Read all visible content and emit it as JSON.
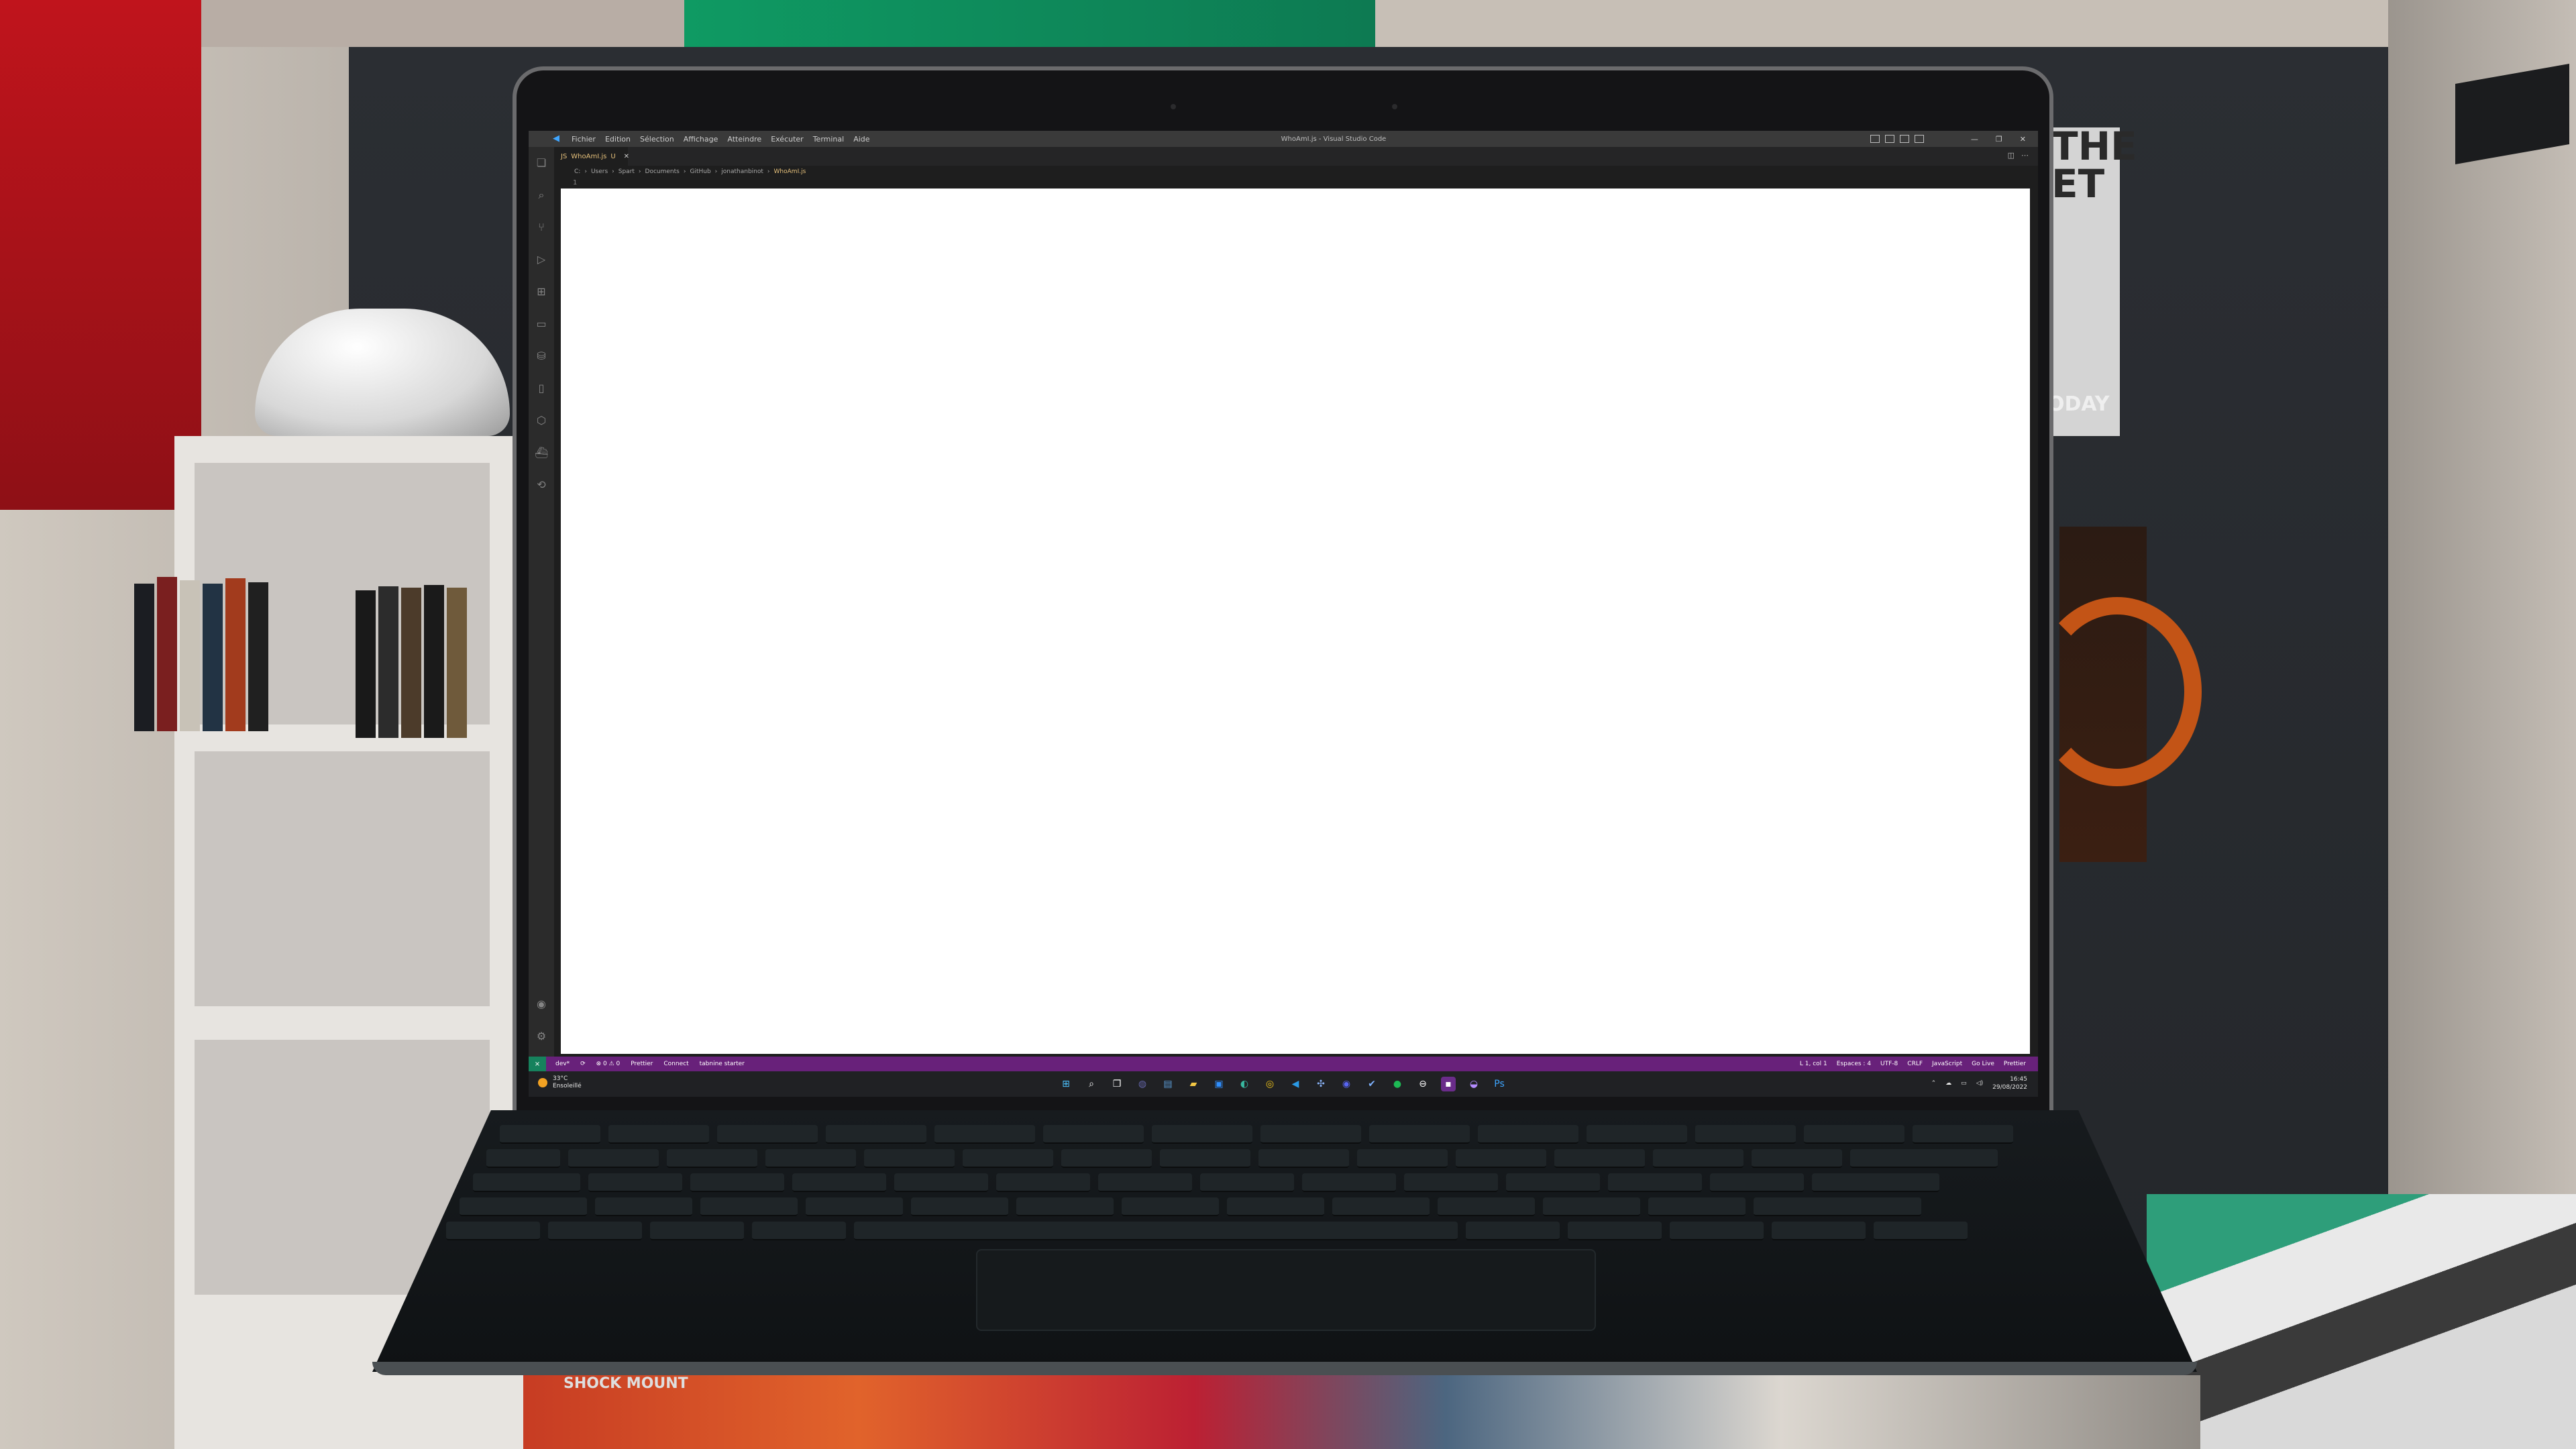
{
  "window": {
    "title": "WhoAmI.js - Visual Studio Code",
    "menu": [
      "Fichier",
      "Edition",
      "Sélection",
      "Affichage",
      "Atteindre",
      "Exécuter",
      "Terminal",
      "Aide"
    ],
    "controls": {
      "minimize": "—",
      "maximize": "❐",
      "close": "✕"
    }
  },
  "tab": {
    "label": "WhoAmI.js",
    "badge": "U",
    "close": "✕"
  },
  "breadcrumb": [
    "C:",
    "Users",
    "Spart",
    "Documents",
    "GitHub",
    "jonathanbinot",
    "WhoAmI.js"
  ],
  "editor": {
    "line_number": "1"
  },
  "statusbar": {
    "remote": "⨯",
    "left": [
      "dev*",
      "⟳",
      "⊗ 0 ⚠ 0",
      "Prettier",
      "Connect",
      "tabnine starter"
    ],
    "right": [
      "L 1, col 1",
      "Espaces : 4",
      "UTF-8",
      "CRLF",
      "JavaScript",
      "Go Live",
      "Prettier"
    ]
  },
  "taskbar": {
    "weather_temp": "33°C",
    "weather_desc": "Ensoleillé",
    "time": "16:45",
    "date": "29/08/2022"
  },
  "background": {
    "poster_text": "THE\nET",
    "poster_footer": "ODAY",
    "floor_label": "SHOCK MOUNT"
  },
  "colors": {
    "statusbar": "#68217a",
    "remote": "#16825d",
    "titlebar": "#3a3a3a",
    "editor": "#1e1e1e"
  },
  "icons": {
    "activity_bar": [
      "files-icon",
      "search-icon",
      "source-control-icon",
      "run-debug-icon",
      "extensions-icon",
      "remote-explorer-icon",
      "database-icon",
      "mobile-icon",
      "kubernetes-icon",
      "docker-icon",
      "gitlens-icon"
    ],
    "activity_bottom": [
      "account-icon",
      "settings-gear-icon"
    ]
  }
}
